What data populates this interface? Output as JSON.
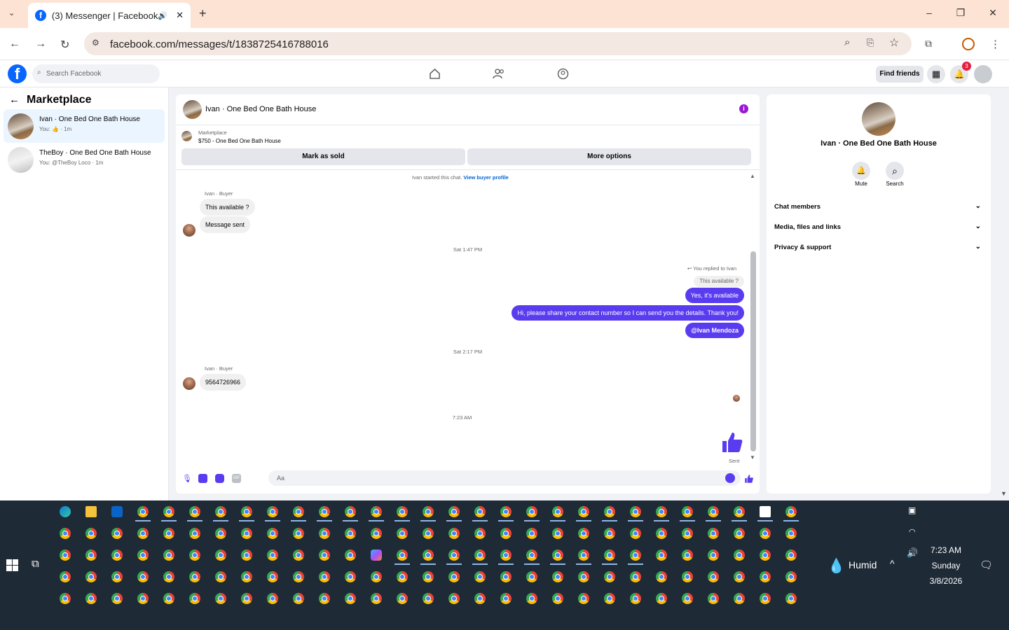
{
  "browser": {
    "tab_title": "(3) Messenger | Facebook",
    "url": "facebook.com/messages/t/1838725416788016"
  },
  "fb": {
    "search_placeholder": "Search Facebook",
    "find_friends": "Find friends",
    "notification_count": "3"
  },
  "sidebar": {
    "title": "Marketplace",
    "conversations": [
      {
        "name": "Ivan · One Bed One Bath House",
        "snippet": "You: 👍 · 1m",
        "selected": true
      },
      {
        "name": "TheBoy · One Bed One Bath House",
        "snippet": "You: @TheBoy Loco · 1m",
        "selected": false
      }
    ]
  },
  "chat": {
    "title": "Ivan · One Bed One Bath House",
    "listing_label": "Marketplace",
    "listing_title": "$750 - One Bed One Bath House",
    "mark_sold": "Mark as sold",
    "more_options": "More options",
    "started_text": "Ivan started this chat.",
    "view_profile": "View buyer profile",
    "sender_label_1": "Ivan · Buyer",
    "msg_in_1": "This available ?",
    "msg_in_2": "Message sent",
    "ts_1": "Sat 1:47 PM",
    "replied_label": "You replied to Ivan",
    "quoted": "This available ?",
    "msg_out_1": "Yes, it's available",
    "msg_out_2": "Hi, please share your contact number so I can send you the details. Thank you!",
    "msg_out_3": "@Ivan Mendoza",
    "ts_2": "Sat 2:17 PM",
    "sender_label_2": "Ivan · Buyer",
    "msg_in_3": "9564726966",
    "ts_3": "7:23 AM",
    "sent_label": "Sent",
    "composer_placeholder": "Aa"
  },
  "details": {
    "name": "Ivan · One Bed One Bath House",
    "mute": "Mute",
    "search": "Search",
    "sections": [
      "Chat members",
      "Media, files and links",
      "Privacy & support"
    ]
  },
  "taskbar": {
    "weather": "Humid",
    "time": "7:23 AM",
    "day": "Sunday",
    "date": "3/8/2026"
  },
  "colors": {
    "accent": "#5a3cf0",
    "fb_blue": "#0866ff",
    "taskbar": "#1f2a37",
    "titlebar": "#fce3d4"
  }
}
